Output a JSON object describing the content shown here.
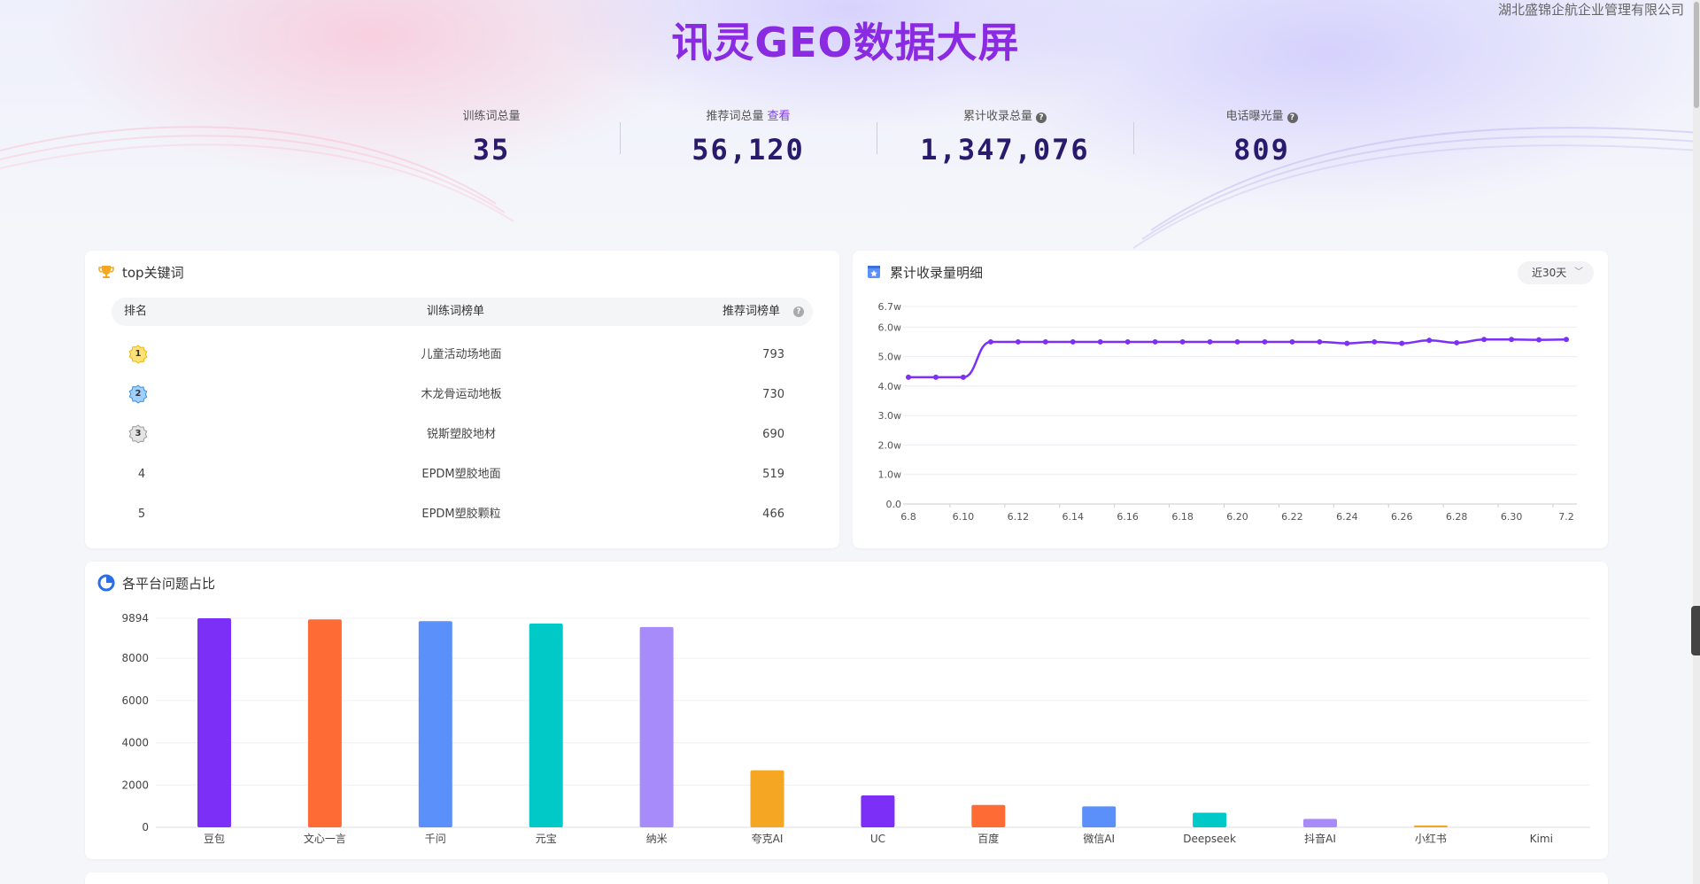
{
  "header": {
    "company": "湖北盛锦企航企业管理有限公司",
    "title": "讯灵GEO数据大屏"
  },
  "stats": [
    {
      "label": "训练词总量",
      "value": "35"
    },
    {
      "label": "推荐词总量",
      "link": "查看",
      "value": "56,120"
    },
    {
      "label": "累计收录总量",
      "help": "?",
      "value": "1,347,076"
    },
    {
      "label": "电话曝光量",
      "help": "?",
      "value": "809"
    }
  ],
  "top_keywords": {
    "title": "top关键词",
    "headers": {
      "rank": "排名",
      "name": "训练词榜单",
      "value": "推荐词榜单",
      "help": "?"
    },
    "rows": [
      {
        "rank": "1",
        "name": "儿童活动场地面",
        "value": "793"
      },
      {
        "rank": "2",
        "name": "木龙骨运动地板",
        "value": "730"
      },
      {
        "rank": "3",
        "name": "锐斯塑胶地材",
        "value": "690"
      },
      {
        "rank": "4",
        "name": "EPDM塑胶地面",
        "value": "519"
      },
      {
        "rank": "5",
        "name": "EPDM塑胶颗粒",
        "value": "466"
      }
    ]
  },
  "cumulative": {
    "title": "累计收录量明细",
    "range_select": "近30天",
    "chev": "﹀"
  },
  "platform": {
    "title": "各平台问题占比"
  },
  "colors": {
    "purple": "#7b2ff7",
    "orange": "#ff6b35",
    "blue": "#5b8ff9",
    "teal": "#00c9c8",
    "lavender": "#a78bfa",
    "amber": "#f5a623"
  },
  "chart_data": [
    {
      "type": "line",
      "x": [
        "6.8",
        "6.9",
        "6.10",
        "6.11",
        "6.12",
        "6.13",
        "6.14",
        "6.15",
        "6.16",
        "6.17",
        "6.18",
        "6.19",
        "6.20",
        "6.21",
        "6.22",
        "6.23",
        "6.24",
        "6.25",
        "6.26",
        "6.27",
        "6.28",
        "6.29",
        "6.30",
        "7.1",
        "7.2"
      ],
      "xticks": [
        "6.8",
        "6.10",
        "6.12",
        "6.14",
        "6.16",
        "6.18",
        "6.20",
        "6.22",
        "6.24",
        "6.26",
        "6.28",
        "6.30",
        "7.2"
      ],
      "values": [
        4.3,
        4.3,
        4.3,
        5.5,
        5.5,
        5.5,
        5.5,
        5.5,
        5.5,
        5.5,
        5.5,
        5.5,
        5.5,
        5.5,
        5.5,
        5.5,
        5.45,
        5.5,
        5.45,
        5.55,
        5.47,
        5.58,
        5.58,
        5.57,
        5.58
      ],
      "yticks": [
        "0.0",
        "1.0w",
        "2.0w",
        "3.0w",
        "4.0w",
        "5.0w",
        "6.0w",
        "6.7w"
      ],
      "ylim": [
        0,
        6.7
      ],
      "grid": true
    },
    {
      "type": "bar",
      "categories": [
        "豆包",
        "文心一言",
        "千问",
        "元宝",
        "纳米",
        "夸克AI",
        "UC",
        "百度",
        "微信AI",
        "Deepseek",
        "抖音AI",
        "小红书",
        "Kimi"
      ],
      "values": [
        9894,
        9840,
        9760,
        9640,
        9480,
        2700,
        1510,
        1060,
        990,
        690,
        400,
        90,
        0
      ],
      "colors": [
        "#7b2ff7",
        "#ff6b35",
        "#5b8ff9",
        "#00c9c8",
        "#a78bfa",
        "#f5a623",
        "#7b2ff7",
        "#ff6b35",
        "#5b8ff9",
        "#00c9c8",
        "#a78bfa",
        "#f5a623",
        "#7b2ff7"
      ],
      "yticks": [
        "0",
        "2000",
        "4000",
        "6000",
        "8000",
        "9894"
      ],
      "ylim": [
        0,
        9894
      ],
      "grid": true
    }
  ]
}
